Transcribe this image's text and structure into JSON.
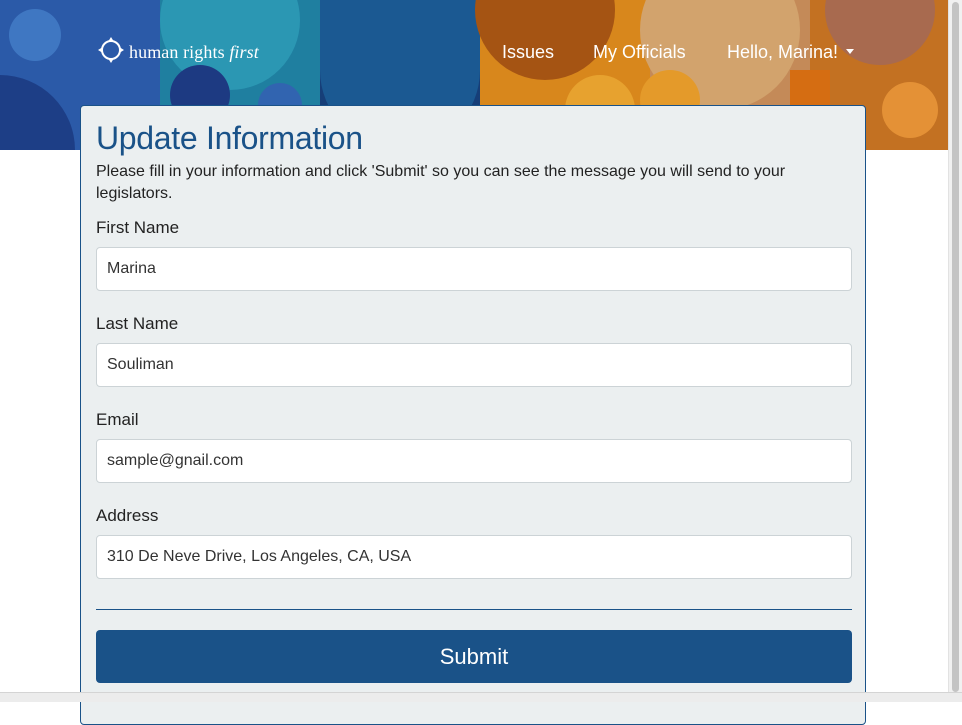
{
  "brand": {
    "name_main": "human rights",
    "name_accent": "first"
  },
  "nav": {
    "issues": "Issues",
    "officials": "My Officials",
    "greeting": "Hello, Marina!"
  },
  "form": {
    "title": "Update Information",
    "instructions": "Please fill in your information and click 'Submit' so you can see the message you will send to your legislators.",
    "fields": [
      {
        "label": "First Name",
        "value": "Marina"
      },
      {
        "label": "Last Name",
        "value": "Souliman"
      },
      {
        "label": "Email",
        "value": "sample@gnail.com"
      },
      {
        "label": "Address",
        "value": "310 De Neve Drive, Los Angeles, CA, USA"
      }
    ],
    "submit_label": "Submit"
  },
  "colors": {
    "primary": "#1a5288",
    "card_background": "#ebeff0",
    "hero_blue": "#2a57a0",
    "hero_orange": "#e28a1f"
  },
  "icons": {
    "logo_mark": "diamond-circle-icon",
    "dropdown": "caret-down-icon"
  }
}
